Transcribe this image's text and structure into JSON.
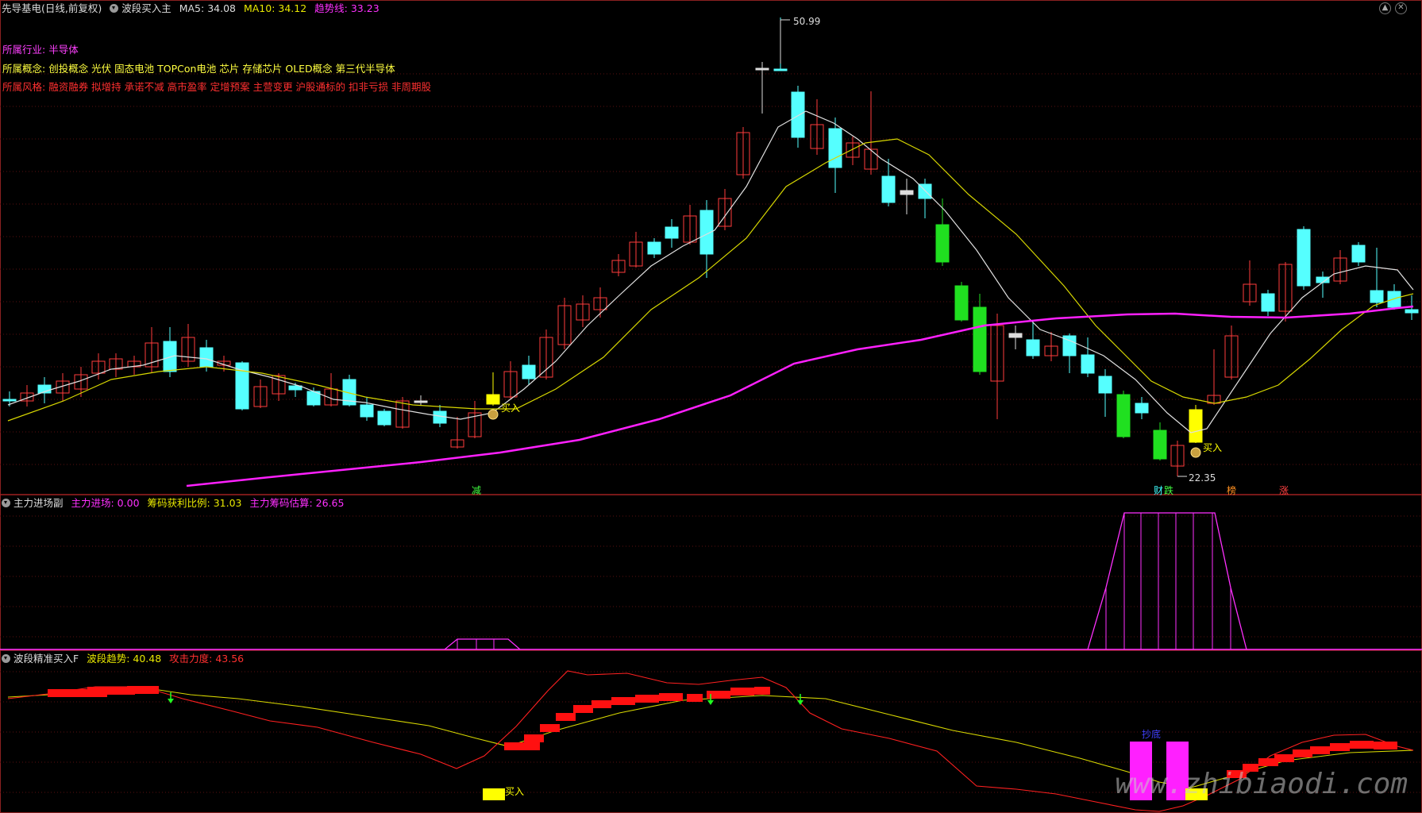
{
  "main_panel": {
    "header": {
      "stock_name": "先导基电(日线,前复权)",
      "indicator": "波段买入主",
      "ma5_label": "MA5: 34.08",
      "ma10_label": "MA10: 34.12",
      "trend_label": "趋势线: 33.23"
    },
    "info_lines": [
      {
        "label": "所属行业:",
        "text": "半导体",
        "color": "#ff40ff"
      },
      {
        "label": "所属概念:",
        "text": "创投概念 光伏 固态电池 TOPCon电池 芯片 存储芯片 OLED概念 第三代半导体",
        "color": "#ffff40"
      },
      {
        "label": "所属风格:",
        "text": "融资融券 拟增持 承诺不减 高市盈率 定增预案 主营变更 沪股通标的 扣非亏损 非周期股",
        "color": "#ff3030"
      }
    ],
    "high_price": "50.99",
    "low_price": "22.35",
    "buy_labels": [
      "买入",
      "买入"
    ],
    "bottom_tags": [
      {
        "text": "减",
        "color": "#40ff40"
      },
      {
        "text": "财",
        "color": "#40ffff"
      },
      {
        "text": "跌",
        "color": "#40ff40"
      },
      {
        "text": "榜",
        "color": "#ff9020"
      },
      {
        "text": "涨",
        "color": "#ff4040"
      }
    ],
    "colors": {
      "up": "#ff3c3c",
      "down": "#55ffff",
      "ma5": "#e0e0e0",
      "ma10": "#d7d700",
      "trend": "#ff20ff",
      "buy": "#ffff00",
      "plunge": "#20e020"
    }
  },
  "panel2": {
    "title": "主力进场副",
    "v1_label": "主力进场: 0.00",
    "v2_label": "筹码获利比例: 31.03",
    "v3_label": "主力筹码估算: 26.65"
  },
  "panel3": {
    "title": "波段精准买入F",
    "v1_label": "波段趋势: 40.48",
    "v2_label": "攻击力度: 43.56",
    "buy_label": "买入",
    "bottom_label": "抄底"
  },
  "watermark": "www.zhibiaodi.com"
}
